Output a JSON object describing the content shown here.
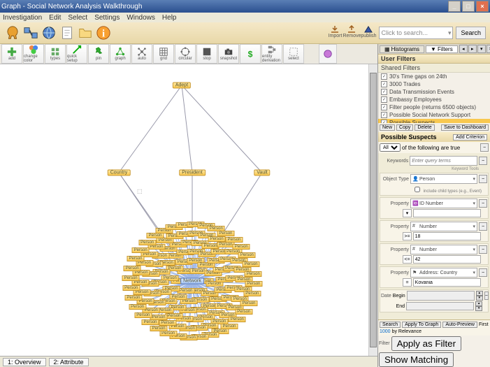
{
  "window": {
    "title": "Graph - Social Network Analysis Walkthrough",
    "minimize": "_",
    "maximize": "□",
    "close": "×"
  },
  "menu": [
    "Investigation",
    "Edit",
    "Select",
    "Settings",
    "Windows",
    "Help"
  ],
  "toolbar": {
    "publish_cols": [
      "Import",
      "Remove",
      "publish"
    ],
    "search_placeholder": "Click to search...",
    "search_btn": "Search"
  },
  "graph_toolbar": [
    {
      "id": "add",
      "label": "add"
    },
    {
      "id": "change-color",
      "label": "change color"
    },
    {
      "id": "types",
      "label": "types"
    },
    {
      "id": "quick-setup",
      "label": "quick setup"
    },
    {
      "id": "pin",
      "label": "pin"
    },
    {
      "id": "graph",
      "label": "graph"
    },
    {
      "id": "auto",
      "label": "auto"
    },
    {
      "id": "grid",
      "label": "grid"
    },
    {
      "id": "circular",
      "label": "circular"
    },
    {
      "id": "stop",
      "label": "stop"
    },
    {
      "id": "snapshot",
      "label": "snapshot"
    },
    {
      "id": "money",
      "label": ""
    },
    {
      "id": "entity-derivation",
      "label": "entity derivation"
    },
    {
      "id": "select",
      "label": "select"
    }
  ],
  "graph": {
    "nodes": {
      "top": "Adept",
      "left": "Country",
      "mid": "President",
      "right": "Vault",
      "center": "Network"
    }
  },
  "status_tabs": [
    "1: Overview",
    "2: Attribute"
  ],
  "right_panel": {
    "tabs": {
      "histogram": "Histograms",
      "filters": "Filters"
    },
    "user_filters": "User Filters",
    "shared_filters": "Shared Filters",
    "filter_list": [
      {
        "label": "30's Time gaps on 24th",
        "checked": true
      },
      {
        "label": "3000 Trades",
        "checked": true
      },
      {
        "label": "Data Transmission Events",
        "checked": true
      },
      {
        "label": "Embassy Employees",
        "checked": true
      },
      {
        "label": "Filter people (returns 6500 objects)",
        "checked": true
      },
      {
        "label": "Possible Social Network Support",
        "checked": true
      },
      {
        "label": "Possible Suspects",
        "checked": true,
        "selected": true
      }
    ],
    "filter_actions": [
      "New",
      "Copy",
      "Delete",
      "Save to Dashboard"
    ],
    "criteria": {
      "title": "Possible Suspects",
      "add_btn": "Add Criterion",
      "match_all": "All",
      "match_text": "of the following are true",
      "keywords_label": "Keywords",
      "keywords_placeholder": "Enter query terms",
      "keywords_hint": "Keyword Tools",
      "rows": [
        {
          "label": "Object Type",
          "value": "Person",
          "icon": "person"
        },
        {
          "label": "Property",
          "value": "ID Number",
          "icon": "id",
          "sub_op": "",
          "sub_val": ""
        },
        {
          "label": "Property",
          "value": "Number",
          "icon": "num",
          "sub_op": ">=",
          "sub_val": "18"
        },
        {
          "label": "Property",
          "value": "Number",
          "icon": "num",
          "sub_op": "<=",
          "sub_val": "42"
        },
        {
          "label": "Property",
          "value": "Address: Country",
          "icon": "flag",
          "sub_op": "=",
          "sub_val": "Kovania"
        }
      ],
      "date_label": "Date",
      "date_begin": "Begin",
      "date_end": "End"
    },
    "footer": {
      "search": "Search",
      "apply": "Apply To Graph",
      "auto": "Auto-Preview",
      "first": "First",
      "count": "1000",
      "by": "by Relevance",
      "filter_lbl": "Filter",
      "apply_filter": "Apply as Filter",
      "show_matching": "Show Matching"
    }
  }
}
